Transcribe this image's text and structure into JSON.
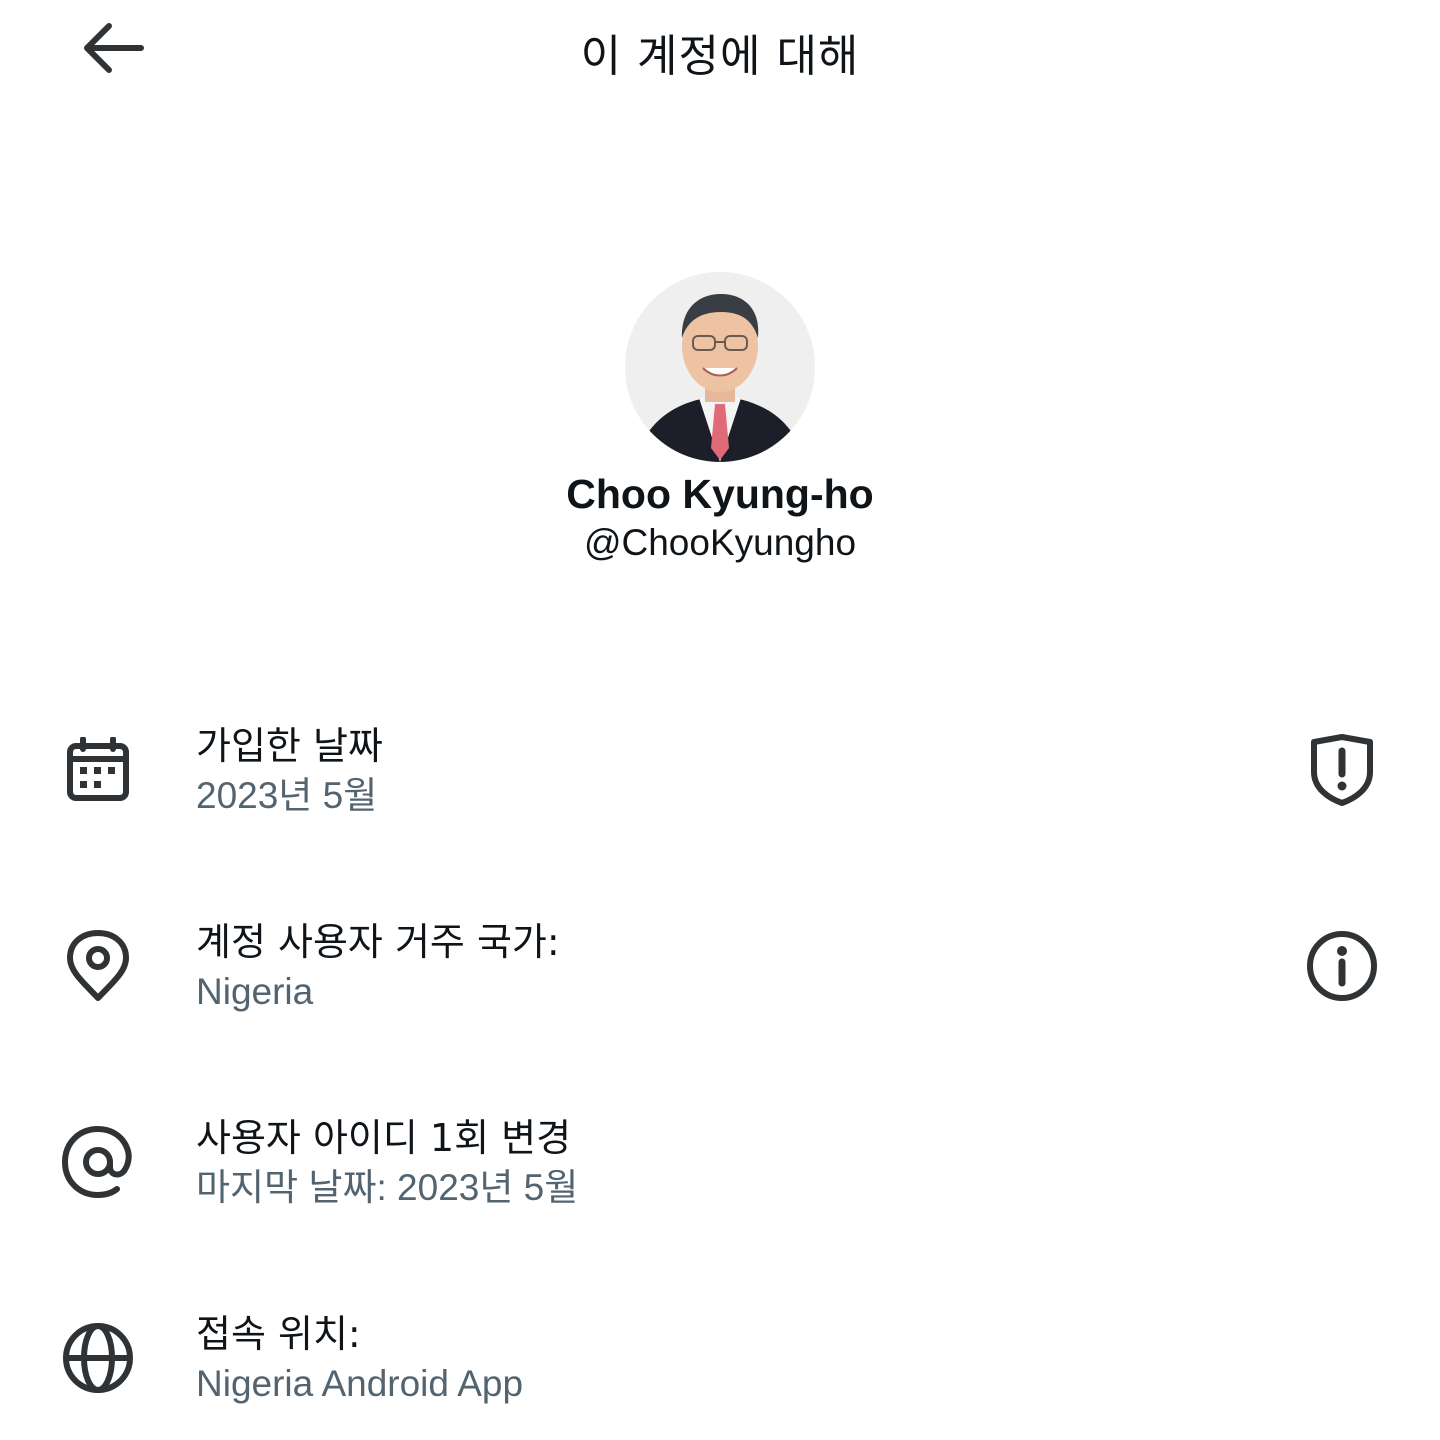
{
  "header": {
    "title": "이 계정에 대해",
    "back_icon": "arrow-left-icon"
  },
  "profile": {
    "display_name": "Choo Kyung-ho",
    "handle": "@ChooKyungho"
  },
  "rows": [
    {
      "icon": "calendar-icon",
      "label": "가입한 날짜",
      "value": "2023년 5월",
      "action_icon": "shield-alert-icon"
    },
    {
      "icon": "location-pin-icon",
      "label": "계정 사용자 거주 국가:",
      "value": "Nigeria",
      "action_icon": "info-icon"
    },
    {
      "icon": "at-sign-icon",
      "label": "사용자 아이디 1회 변경",
      "value": "마지막 날짜: 2023년 5월"
    },
    {
      "icon": "globe-icon",
      "label": "접속 위치:",
      "value": "Nigeria Android App"
    }
  ],
  "colors": {
    "text_primary": "#0f1419",
    "text_secondary": "#536471",
    "icon": "#2f3336",
    "background": "#ffffff"
  }
}
